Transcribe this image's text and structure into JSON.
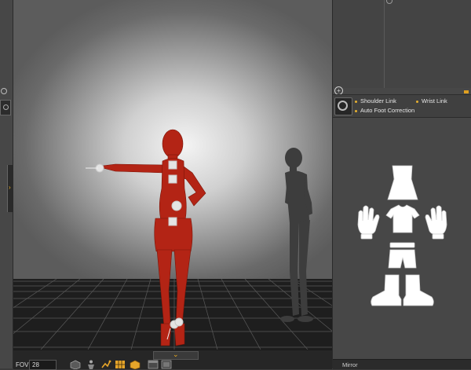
{
  "viewport": {
    "fov_label": "FOV",
    "fov_value": "28"
  },
  "right_panel": {
    "options": [
      "Shoulder Link",
      "Wrist Link",
      "Auto Foot Correction"
    ],
    "mirror_label": "Mirror"
  },
  "colors": {
    "figure": "#b32415",
    "accent": "#e6a52a",
    "panel": "#474747",
    "shadow_figure": "#3d3d3d"
  },
  "icons": {
    "left_strip": [
      "add-icon",
      "tool-icon",
      "expand-icon"
    ],
    "toolbar": [
      "cube-icon",
      "figure-icon",
      "bone-icon",
      "grid-icon",
      "box-icon",
      "window-icon"
    ],
    "body_parts": [
      "head-icon",
      "shirt-icon",
      "left-hand-icon",
      "right-hand-icon",
      "shorts-icon",
      "feet-icon"
    ]
  }
}
